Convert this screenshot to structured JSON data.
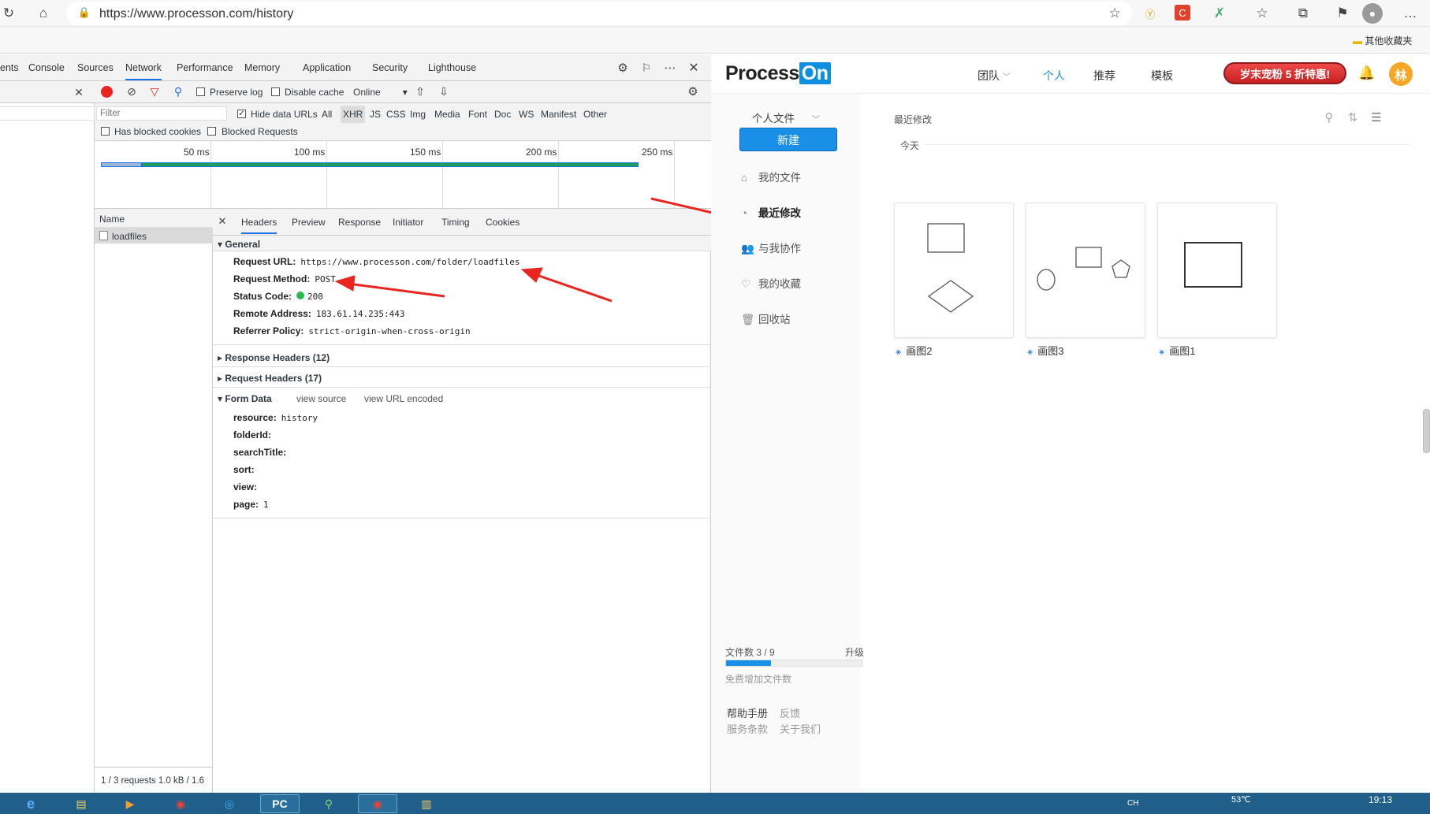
{
  "browser": {
    "url": "https://www.processon.com/history",
    "favorites_folder": "其他收藏夹"
  },
  "devtools": {
    "tabs": [
      "ents",
      "Console",
      "Sources",
      "Network",
      "Performance",
      "Memory",
      "Application",
      "Security",
      "Lighthouse"
    ],
    "active_tab": "Network",
    "toolbar": {
      "preserve_log": "Preserve log",
      "disable_cache": "Disable cache",
      "throttle": "Online"
    },
    "filter": {
      "placeholder": "Filter",
      "hide_data_urls": "Hide data URLs",
      "types": [
        "All",
        "XHR",
        "JS",
        "CSS",
        "Img",
        "Media",
        "Font",
        "Doc",
        "WS",
        "Manifest",
        "Other"
      ],
      "active_type": "XHR",
      "has_blocked_cookies": "Has blocked cookies",
      "blocked_requests": "Blocked Requests"
    },
    "timeline_ticks": [
      "50 ms",
      "100 ms",
      "150 ms",
      "200 ms",
      "250 ms"
    ],
    "name_col": {
      "header": "Name",
      "rows": [
        "loadfiles"
      ],
      "status": "1 / 3 requests  1.0 kB / 1.6"
    },
    "detail_tabs": [
      "Headers",
      "Preview",
      "Response",
      "Initiator",
      "Timing",
      "Cookies"
    ],
    "detail_active": "Headers",
    "general": {
      "title": "General",
      "request_url_label": "Request URL:",
      "request_url": "https://www.processon.com/folder/loadfiles",
      "method_label": "Request Method:",
      "method": "POST",
      "status_label": "Status Code:",
      "status": "200",
      "remote_label": "Remote Address:",
      "remote": "183.61.14.235:443",
      "referrer_label": "Referrer Policy:",
      "referrer": "strict-origin-when-cross-origin"
    },
    "response_headers": "Response Headers (12)",
    "request_headers": "Request Headers (17)",
    "form_data": {
      "title": "Form Data",
      "view_source": "view source",
      "view_url_encoded": "view URL encoded",
      "resource_label": "resource:",
      "resource": "history",
      "folderid_label": "folderId:",
      "searchtitle_label": "searchTitle:",
      "sort_label": "sort:",
      "view_label": "view:",
      "page_label": "page:",
      "page": "1"
    }
  },
  "app": {
    "logo_a": "Process",
    "logo_b": "On",
    "nav": [
      "团队",
      "个人",
      "推荐",
      "模板"
    ],
    "nav_active": "个人",
    "promo": "岁末宠粉 5 折特惠!",
    "avatar": "林",
    "sidebar": {
      "folder": "个人文件",
      "new_button": "新建",
      "items": [
        "我的文件",
        "最近修改",
        "与我协作",
        "我的收藏",
        "回收站"
      ],
      "active": "最近修改",
      "quota_label": "文件数 3 / 9",
      "quota_fraction": 0.333,
      "upgrade": "升级",
      "free_increase": "免费增加文件数",
      "links": [
        "帮助手册",
        "反馈",
        "服务条款",
        "关于我们"
      ]
    },
    "main": {
      "title": "最近修改",
      "section": "今天",
      "cards": [
        "画图2",
        "画图3",
        "画图1"
      ]
    }
  },
  "taskbar": {
    "temp": "53℃",
    "time": "19:13",
    "lang": "CH"
  }
}
